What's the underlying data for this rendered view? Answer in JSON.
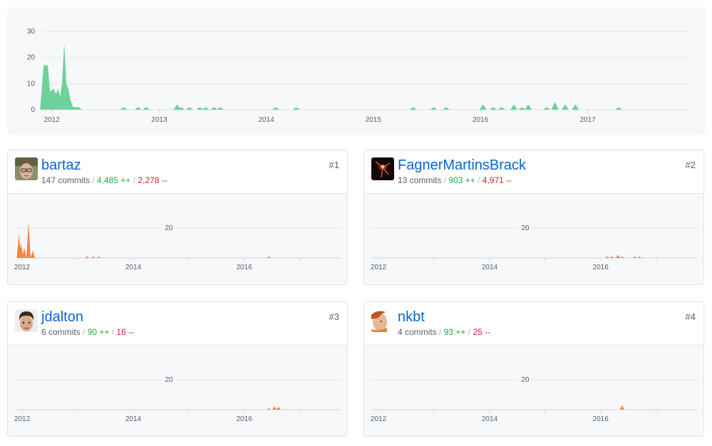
{
  "main": {
    "y_ticks": [
      "0",
      "10",
      "20",
      "30"
    ],
    "x_ticks": [
      "2012",
      "2013",
      "2014",
      "2015",
      "2016",
      "2017"
    ],
    "color": "#6dd19b"
  },
  "contributors": [
    {
      "username": "bartaz",
      "commits": "147 commits",
      "additions": "4,485 ++",
      "deletions": "2,278 --",
      "rank": "#1",
      "y_tick": "20",
      "x_ticks": [
        "2012",
        "2014",
        "2016"
      ],
      "avatar_icon": "avatar-man-glasses"
    },
    {
      "username": "FagnerMartinsBrack",
      "commits": "13 commits",
      "additions": "903 ++",
      "deletions": "4,971 --",
      "rank": "#2",
      "y_tick": "20",
      "x_ticks": [
        "2012",
        "2014",
        "2016"
      ],
      "avatar_icon": "avatar-dark-figure"
    },
    {
      "username": "jdalton",
      "commits": "6 commits",
      "additions": "90 ++",
      "deletions": "16 --",
      "rank": "#3",
      "y_tick": "20",
      "x_ticks": [
        "2012",
        "2014",
        "2016"
      ],
      "avatar_icon": "avatar-man-curly-hair"
    },
    {
      "username": "nkbt",
      "commits": "4 commits",
      "additions": "93 ++",
      "deletions": "25 --",
      "rank": "#4",
      "y_tick": "20",
      "x_ticks": [
        "2012",
        "2014",
        "2016"
      ],
      "avatar_icon": "avatar-man-red-hair"
    }
  ],
  "contrib_color": "#f9833e",
  "chart_data": [
    {
      "type": "area",
      "title": "",
      "xlabel": "",
      "ylabel": "",
      "ylim": [
        0,
        30
      ],
      "x_range": [
        "2011-12",
        "2017-12"
      ],
      "series": [
        {
          "x": [
            "2011-12-04",
            "2011-12-18",
            "2011-12-25",
            "2012-01-08",
            "2012-01-15",
            "2012-01-22",
            "2012-01-29",
            "2012-02-05",
            "2012-02-12",
            "2012-02-19",
            "2012-02-26",
            "2012-03-04",
            "2012-03-11",
            "2012-03-18",
            "2012-04-01",
            "2012-09-02",
            "2012-10-21",
            "2012-11-18",
            "2013-03-03",
            "2013-03-17",
            "2013-04-14",
            "2013-05-19",
            "2013-06-09",
            "2013-07-07",
            "2013-07-28",
            "2014-02-02",
            "2014-04-13",
            "2015-05-17",
            "2015-07-26",
            "2015-09-06",
            "2016-01-10",
            "2016-02-14",
            "2016-03-13",
            "2016-04-24",
            "2016-05-22",
            "2016-06-12",
            "2016-08-14",
            "2016-09-11",
            "2016-10-16",
            "2016-11-20",
            "2017-04-16"
          ],
          "y": [
            17,
            17,
            7,
            8,
            6,
            8,
            5,
            10,
            25,
            10,
            8,
            4,
            1,
            1,
            1,
            1,
            1,
            1,
            2,
            1,
            1,
            1,
            1,
            1,
            1,
            1,
            1,
            1,
            1,
            1,
            2,
            1,
            1,
            2,
            1,
            2,
            1,
            3,
            2,
            2,
            1
          ]
        }
      ]
    },
    {
      "type": "area",
      "title": "",
      "xlabel": "",
      "ylabel": "",
      "ylim": [
        0,
        30
      ],
      "series": [
        {
          "name": "bartaz",
          "x": [
            "2011-12-11",
            "2011-12-25",
            "2012-01-15",
            "2012-02-12",
            "2012-03-11",
            "2013-03-03",
            "2013-04-14",
            "2013-05-19",
            "2016-06-12"
          ],
          "y": [
            16,
            10,
            7,
            24,
            5,
            1,
            1,
            1,
            1
          ]
        }
      ]
    },
    {
      "type": "area",
      "title": "",
      "xlabel": "",
      "ylabel": "",
      "ylim": [
        0,
        30
      ],
      "series": [
        {
          "name": "FagnerMartinsBrack",
          "x": [
            "2016-02-14",
            "2016-03-13",
            "2016-04-24",
            "2016-05-22",
            "2016-08-14",
            "2016-09-11"
          ],
          "y": [
            1,
            1,
            2,
            1,
            1,
            1
          ]
        }
      ]
    },
    {
      "type": "area",
      "title": "",
      "xlabel": "",
      "ylabel": "",
      "ylim": [
        0,
        30
      ],
      "series": [
        {
          "name": "jdalton",
          "x": [
            "2016-06-12",
            "2016-07-17",
            "2016-08-14"
          ],
          "y": [
            1,
            2,
            2
          ]
        }
      ]
    },
    {
      "type": "area",
      "title": "",
      "xlabel": "",
      "ylabel": "",
      "ylim": [
        0,
        30
      ],
      "series": [
        {
          "name": "nkbt",
          "x": [
            "2016-05-22"
          ],
          "y": [
            3
          ]
        }
      ]
    }
  ]
}
